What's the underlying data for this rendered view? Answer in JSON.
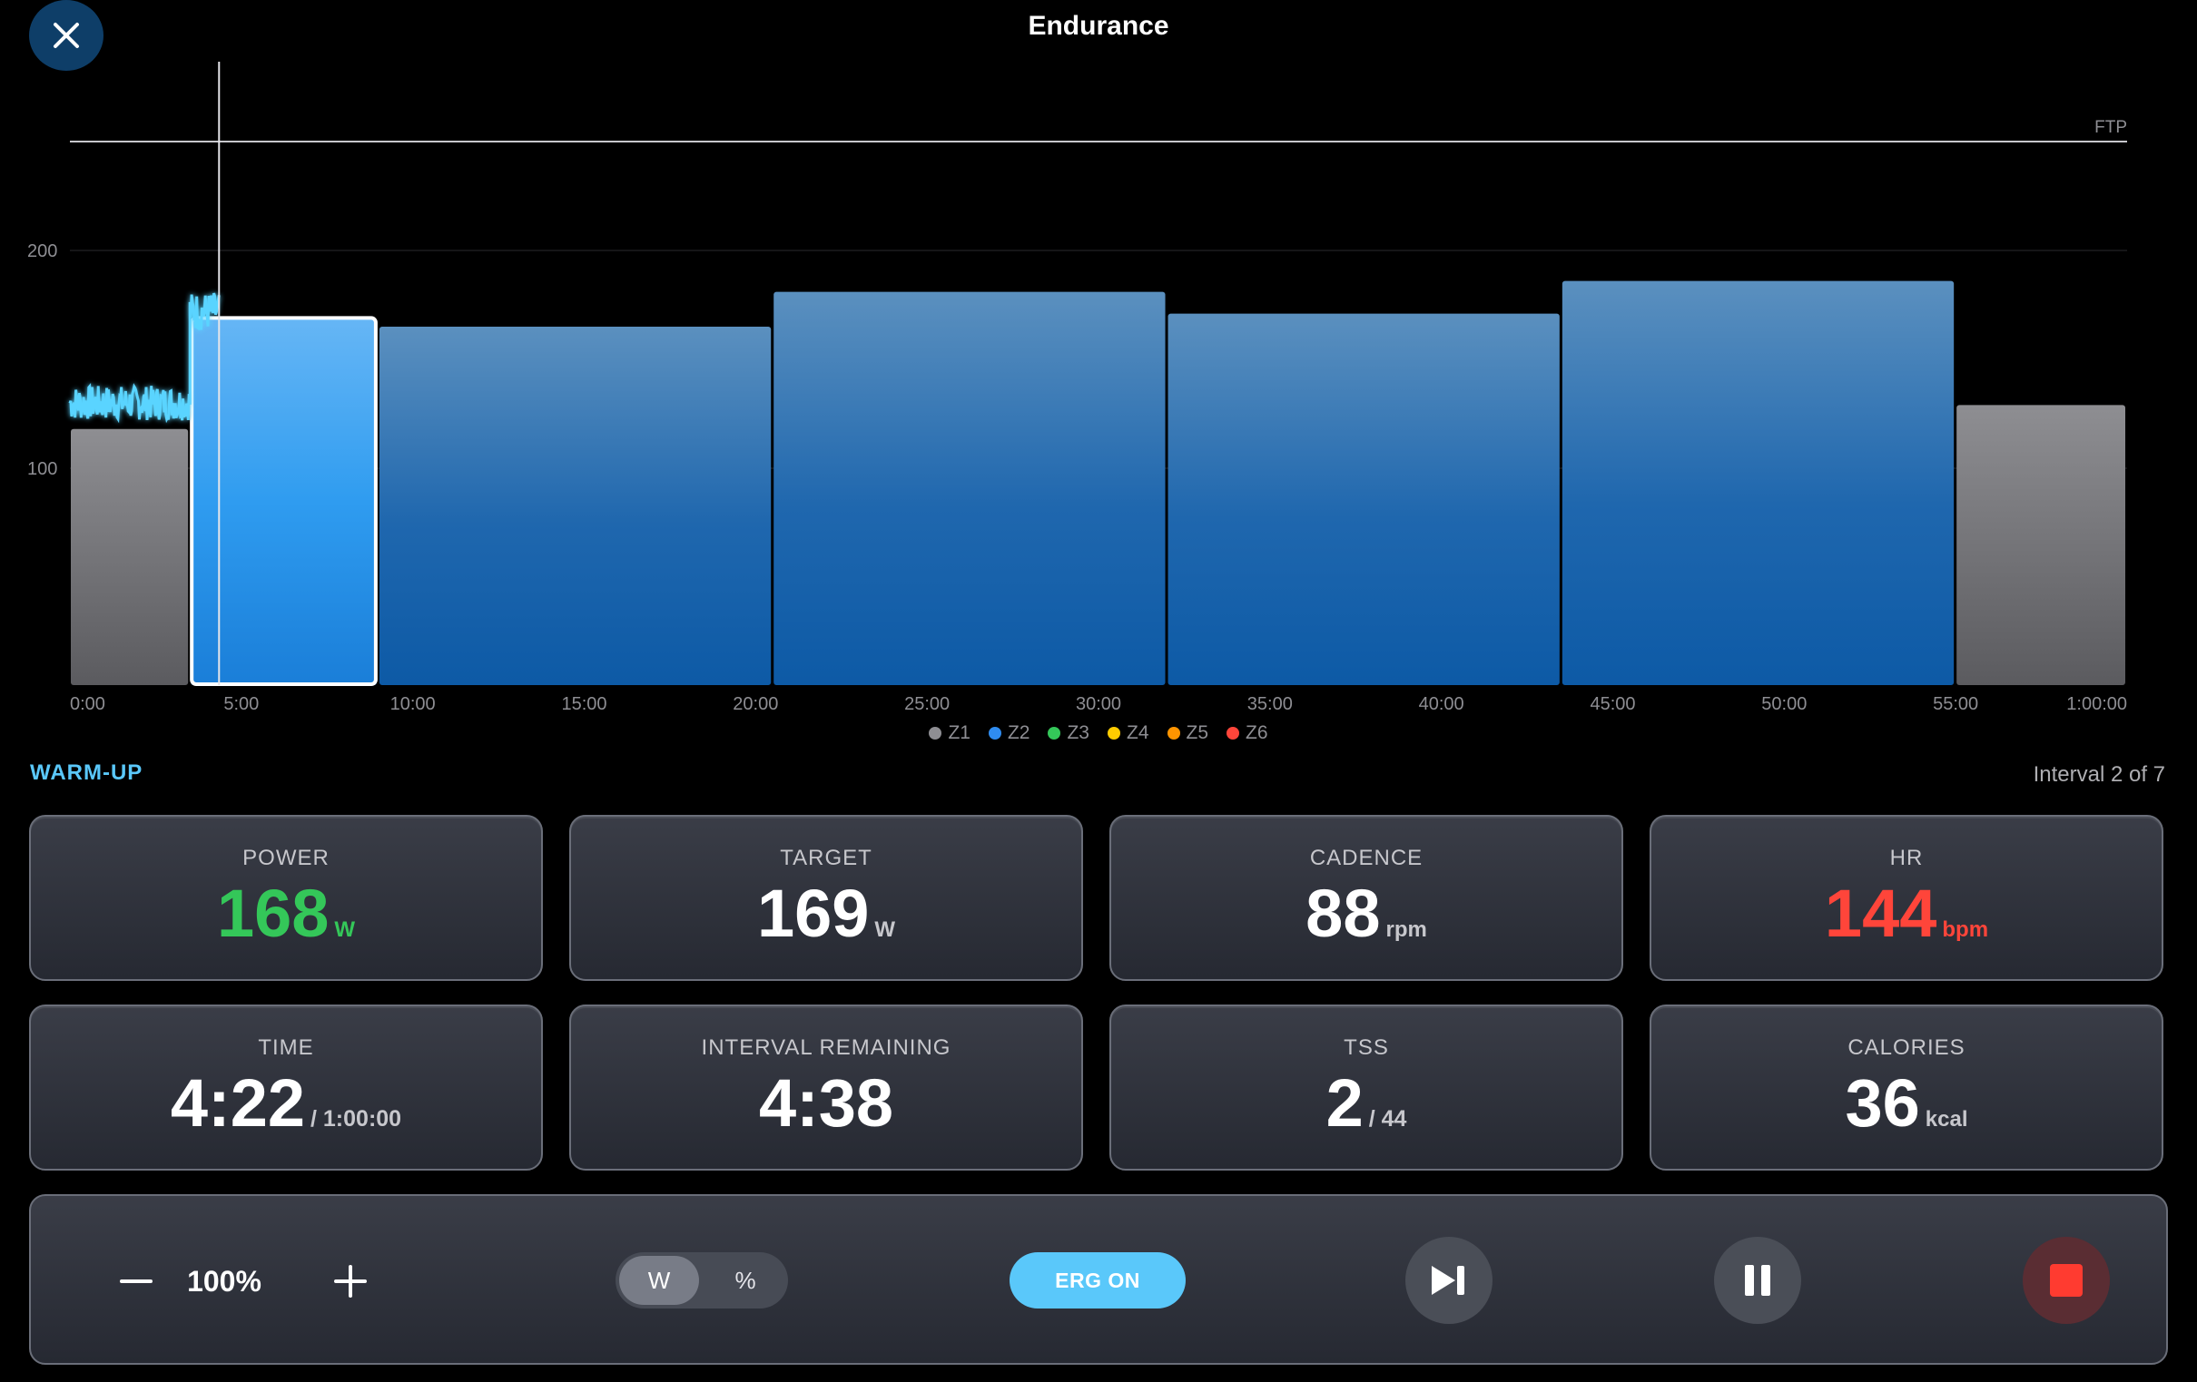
{
  "header": {
    "title": "Endurance",
    "close_icon": "close-icon"
  },
  "chart_data": {
    "type": "bar",
    "description_free": true,
    "x_unit": "min",
    "xlim": [
      0,
      60
    ],
    "ylim": [
      0,
      265
    ],
    "y_ticks": [
      100,
      200
    ],
    "y_tick_labels": [
      "100",
      "200"
    ],
    "x_ticks": [
      0,
      5,
      10,
      15,
      20,
      25,
      30,
      35,
      40,
      45,
      50,
      55,
      60
    ],
    "x_tick_labels": [
      "0:00",
      "5:00",
      "10:00",
      "15:00",
      "20:00",
      "25:00",
      "30:00",
      "35:00",
      "40:00",
      "45:00",
      "50:00",
      "55:00",
      "1:00:00"
    ],
    "ftp": {
      "label": "FTP",
      "value": 250
    },
    "intervals": [
      {
        "start": 0,
        "end": 3.5,
        "value": 118,
        "zone": "Z1"
      },
      {
        "start": 3.5,
        "end": 9,
        "value": 169,
        "zone": "Z2",
        "current": true
      },
      {
        "start": 9,
        "end": 20.5,
        "value": 165,
        "zone": "Z2"
      },
      {
        "start": 20.5,
        "end": 32,
        "value": 181,
        "zone": "Z2"
      },
      {
        "start": 32,
        "end": 43.5,
        "value": 171,
        "zone": "Z2"
      },
      {
        "start": 43.5,
        "end": 55,
        "value": 186,
        "zone": "Z2"
      },
      {
        "start": 55,
        "end": 60,
        "value": 129,
        "zone": "Z1"
      }
    ],
    "cursor_time": 4.35,
    "power_trace": {
      "color": "#5ad4ff",
      "segments": [
        {
          "start": 0,
          "end": 3.5,
          "mean": 130,
          "noise": 8
        },
        {
          "start": 3.5,
          "end": 4.35,
          "mean": 172,
          "noise": 9
        }
      ]
    },
    "legend": [
      {
        "label": "Z1",
        "color": "#8e8e93"
      },
      {
        "label": "Z2",
        "color": "#2f8cf0"
      },
      {
        "label": "Z3",
        "color": "#34c759"
      },
      {
        "label": "Z4",
        "color": "#ffcc00"
      },
      {
        "label": "Z5",
        "color": "#ff9500"
      },
      {
        "label": "Z6",
        "color": "#ff453a"
      }
    ]
  },
  "status": {
    "phase": "WARM-UP",
    "interval": "Interval 2 of 7"
  },
  "metrics": {
    "power": {
      "label": "POWER",
      "value": "168",
      "unit": "W"
    },
    "target": {
      "label": "TARGET",
      "value": "169",
      "unit": "W"
    },
    "cadence": {
      "label": "CADENCE",
      "value": "88",
      "unit": "rpm"
    },
    "hr": {
      "label": "HR",
      "value": "144",
      "unit": "bpm"
    },
    "time": {
      "label": "TIME",
      "value": "4:22",
      "sub": "/ 1:00:00"
    },
    "interval_remaining": {
      "label": "INTERVAL REMAINING",
      "value": "4:38"
    },
    "tss": {
      "label": "TSS",
      "value": "2",
      "sub": "/ 44"
    },
    "calories": {
      "label": "CALORIES",
      "value": "36",
      "unit": "kcal"
    }
  },
  "controls": {
    "zoom_value": "100%",
    "unit_toggle": {
      "watts": "W",
      "percent": "%",
      "selected": "W"
    },
    "erg_label": "ERG ON",
    "icons": [
      "minus-icon",
      "plus-icon",
      "skip-icon",
      "pause-icon",
      "stop-icon"
    ],
    "colors": {
      "accent": "#5ac8fa",
      "stop": "#ff3b30"
    }
  }
}
